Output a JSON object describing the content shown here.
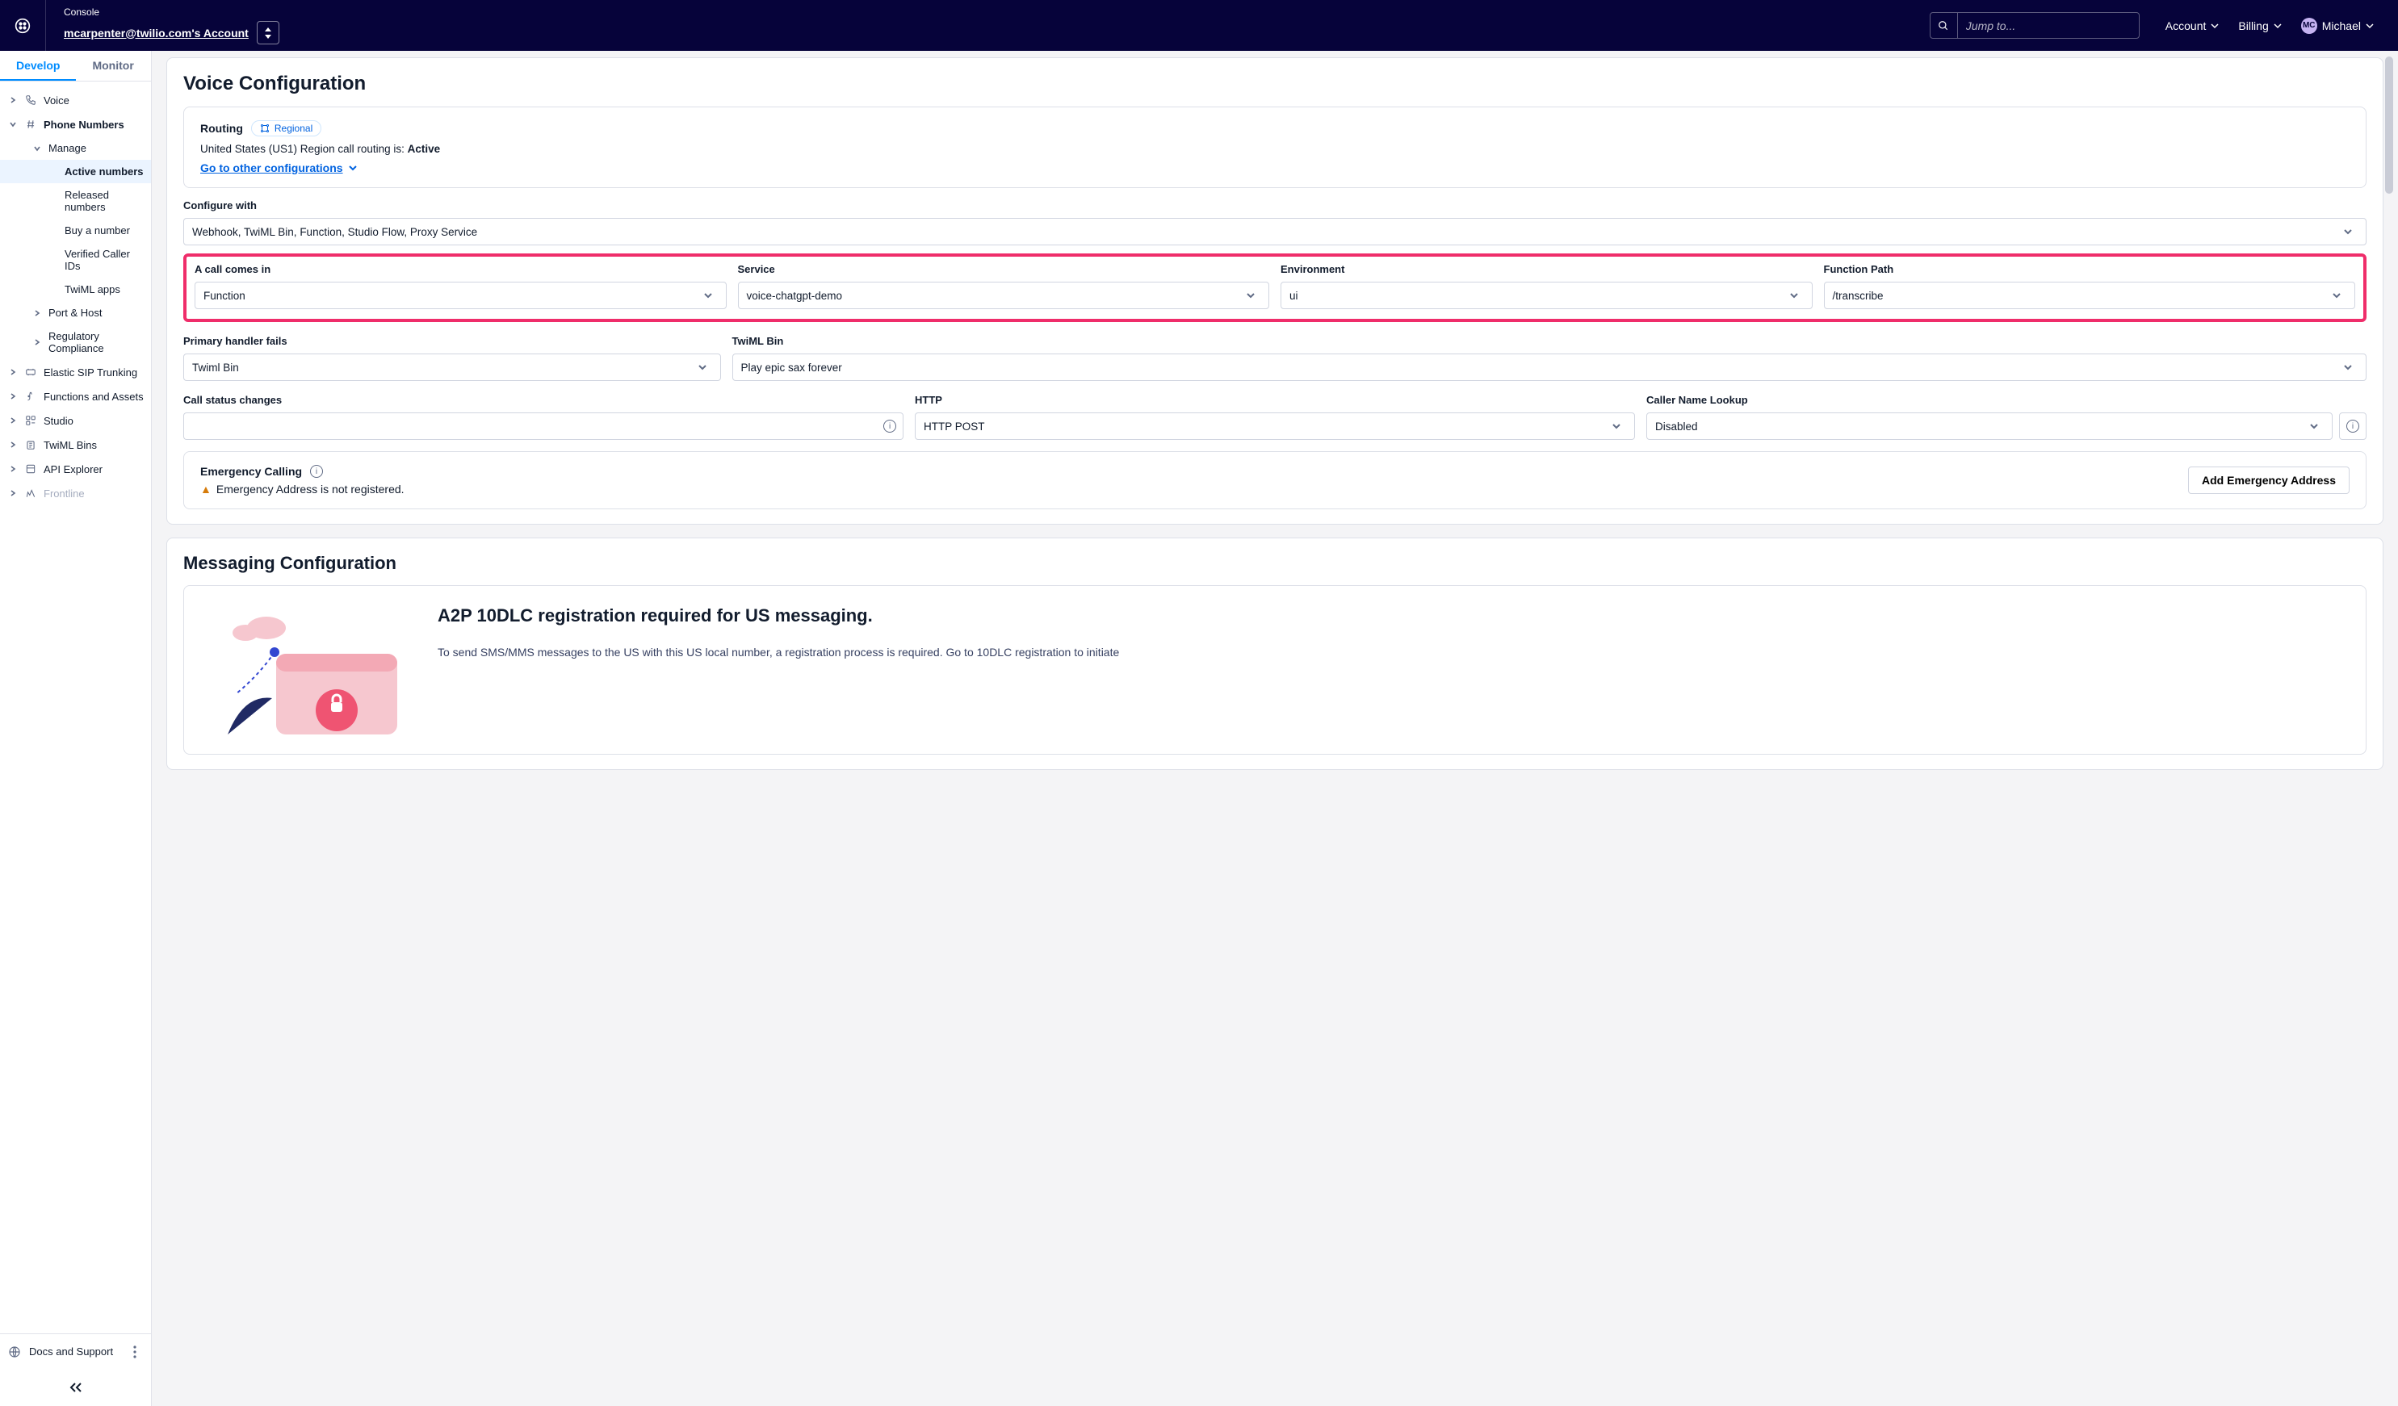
{
  "colors": {
    "topbar": "#06033a",
    "accent": "#0263e0",
    "tab_active": "#008cff",
    "highlight": "#ef2d6a"
  },
  "header": {
    "console_label": "Console",
    "account_link": "mcarpenter@twilio.com's Account",
    "search_placeholder": "Jump to...",
    "account_menu": "Account",
    "billing_menu": "Billing",
    "user_initials": "MC",
    "user_name": "Michael"
  },
  "tabs": {
    "develop": "Develop",
    "monitor": "Monitor"
  },
  "sidebar": {
    "items": [
      {
        "label": "Voice",
        "depth": 1,
        "chev": "right",
        "icon": "phone"
      },
      {
        "label": "Phone Numbers",
        "depth": 1,
        "chev": "down",
        "icon": "hash",
        "bold": true
      },
      {
        "label": "Manage",
        "depth": 2,
        "chev": "down"
      },
      {
        "label": "Active numbers",
        "depth": 3,
        "selected": true
      },
      {
        "label": "Released numbers",
        "depth": 3
      },
      {
        "label": "Buy a number",
        "depth": 3
      },
      {
        "label": "Verified Caller IDs",
        "depth": 3
      },
      {
        "label": "TwiML apps",
        "depth": 3
      },
      {
        "label": "Port & Host",
        "depth": 2,
        "chev": "right"
      },
      {
        "label": "Regulatory Compliance",
        "depth": 2,
        "chev": "right"
      },
      {
        "label": "Elastic SIP Trunking",
        "depth": 1,
        "chev": "right",
        "icon": "sip"
      },
      {
        "label": "Functions and Assets",
        "depth": 1,
        "chev": "right",
        "icon": "fn"
      },
      {
        "label": "Studio",
        "depth": 1,
        "chev": "right",
        "icon": "studio"
      },
      {
        "label": "TwiML Bins",
        "depth": 1,
        "chev": "right",
        "icon": "bin"
      },
      {
        "label": "API Explorer",
        "depth": 1,
        "chev": "right",
        "icon": "api"
      },
      {
        "label": "Frontline",
        "depth": 1,
        "chev": "right",
        "faded": true,
        "icon": "fl"
      }
    ],
    "docs_label": "Docs and Support"
  },
  "voice": {
    "title": "Voice Configuration",
    "routing_label": "Routing",
    "chip_label": "Regional",
    "routing_text_prefix": "United States (US1) Region call routing is: ",
    "routing_status": "Active",
    "go_other": "Go to other configurations",
    "configure_with_label": "Configure with",
    "configure_with_value": "Webhook, TwiML Bin, Function, Studio Flow, Proxy Service",
    "a_call_comes_in_label": "A call comes in",
    "a_call_comes_in_value": "Function",
    "service_label": "Service",
    "service_value": "voice-chatgpt-demo",
    "environment_label": "Environment",
    "environment_value": "ui",
    "function_path_label": "Function Path",
    "function_path_value": "/transcribe",
    "primary_handler_label": "Primary handler fails",
    "primary_handler_value": "Twiml Bin",
    "twiml_bin_label": "TwiML Bin",
    "twiml_bin_value": "Play epic sax forever",
    "call_status_label": "Call status changes",
    "call_status_value": "",
    "http_label": "HTTP",
    "http_value": "HTTP POST",
    "caller_lookup_label": "Caller Name Lookup",
    "caller_lookup_value": "Disabled",
    "emergency_title": "Emergency Calling",
    "emergency_msg": "Emergency Address is not registered.",
    "emergency_btn": "Add Emergency Address"
  },
  "messaging": {
    "title": "Messaging Configuration",
    "banner_title": "A2P 10DLC registration required for US messaging.",
    "banner_body": "To send SMS/MMS messages to the US with this US local number, a registration process is required. Go to 10DLC registration to initiate"
  }
}
